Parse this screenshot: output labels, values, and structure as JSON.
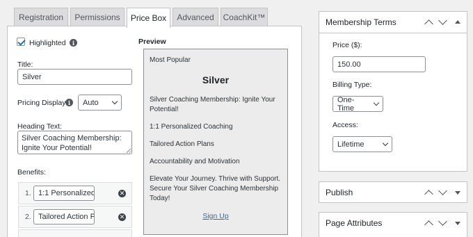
{
  "tabs": [
    {
      "label": "Registration"
    },
    {
      "label": "Permissions"
    },
    {
      "label": "Price Box"
    },
    {
      "label": "Advanced"
    },
    {
      "label": "CoachKit™"
    }
  ],
  "form": {
    "highlighted_label": "Highlighted",
    "title_label": "Title:",
    "title_value": "Silver",
    "pricing_display_label": "Pricing Display",
    "pricing_display_value": "Auto",
    "heading_text_label": "Heading Text:",
    "heading_text_value": "Silver Coaching Membership: Ignite Your Potential!",
    "benefits_label": "Benefits:",
    "benefits": [
      {
        "num": "1.",
        "value": "1:1 Personalized"
      },
      {
        "num": "2.",
        "value": "Tailored Action P"
      }
    ]
  },
  "preview": {
    "label": "Preview",
    "badge": "Most Popular",
    "title": "Silver",
    "heading": "Silver Coaching Membership: Ignite Your Potential!",
    "benefits": [
      "1:1 Personalized Coaching",
      "Tailored Action Plans",
      "Accountability and Motivation"
    ],
    "footer": "Elevate Your Journey. Thrive with Support. Secure Your Silver Coaching Membership Today!",
    "button": "Sign Up"
  },
  "sidebar": {
    "membership_terms": {
      "title": "Membership Terms",
      "price_label": "Price ($):",
      "price_value": "150.00",
      "billing_label": "Billing Type:",
      "billing_value": "One-Time",
      "access_label": "Access:",
      "access_value": "Lifetime"
    },
    "publish": {
      "title": "Publish"
    },
    "page_attributes": {
      "title": "Page Attributes"
    }
  },
  "colors": {
    "accent": "#2271b1",
    "border": "#c3c4c7",
    "background": "#f0f0f1"
  }
}
